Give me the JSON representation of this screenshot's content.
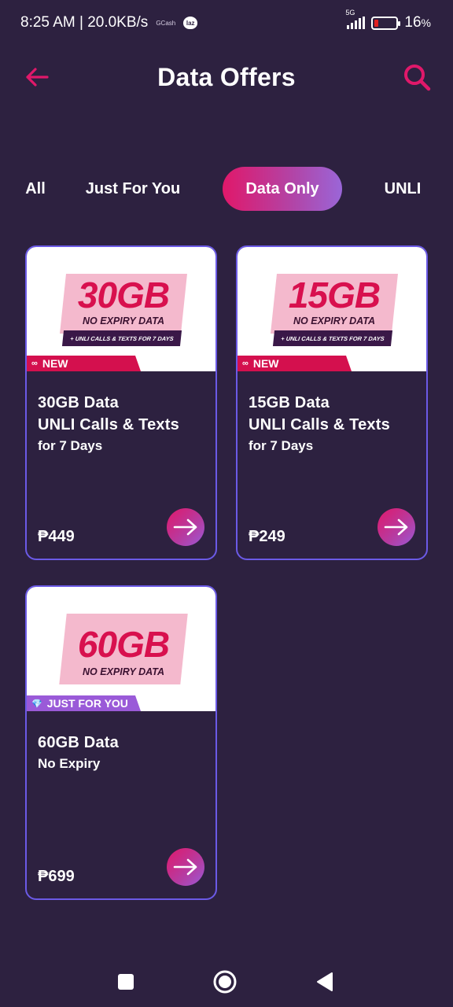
{
  "status_bar": {
    "time_speed": "8:25 AM | 20.0KB/s",
    "gcash": "GCash",
    "laz": "laz",
    "network": "5G",
    "battery_percent_text": "16",
    "battery_unit": "%",
    "battery_level": 0.16
  },
  "header": {
    "title": "Data Offers",
    "back_icon": "arrow-left-icon",
    "search_icon": "search-icon"
  },
  "tabs": [
    {
      "label": "All",
      "active": false
    },
    {
      "label": "Just For You",
      "active": false
    },
    {
      "label": "Data Only",
      "active": true
    },
    {
      "label": "UNLI",
      "active": false
    }
  ],
  "cards": [
    {
      "promo_gb": "30GB",
      "promo_sub": "NO EXPIRY DATA",
      "promo_ribbon": "+ UNLI CALLS & TEXTS FOR 7 DAYS",
      "badge": "NEW",
      "line1": "30GB Data",
      "line2": "UNLI Calls & Texts",
      "line3": "for 7 Days",
      "price": "₱449"
    },
    {
      "promo_gb": "15GB",
      "promo_sub": "NO EXPIRY DATA",
      "promo_ribbon": "+ UNLI CALLS & TEXTS FOR 7 DAYS",
      "badge": "NEW",
      "line1": "15GB Data",
      "line2": "UNLI Calls & Texts",
      "line3": "for 7 Days",
      "price": "₱249"
    },
    {
      "promo_gb": "60GB",
      "promo_sub": "NO EXPIRY DATA",
      "badge": "JUST FOR YOU",
      "line1": "60GB Data",
      "line2": "No Expiry",
      "price": "₱699"
    }
  ],
  "colors": {
    "background": "#2d2140",
    "accent": "#e0186a",
    "card_border": "#6b5ae6",
    "badge_new": "#d4104e",
    "badge_jfy": "#9a5ad8"
  },
  "navbar": {
    "recent_icon": "square-icon",
    "home_icon": "circle-icon",
    "back_icon": "triangle-back-icon"
  }
}
